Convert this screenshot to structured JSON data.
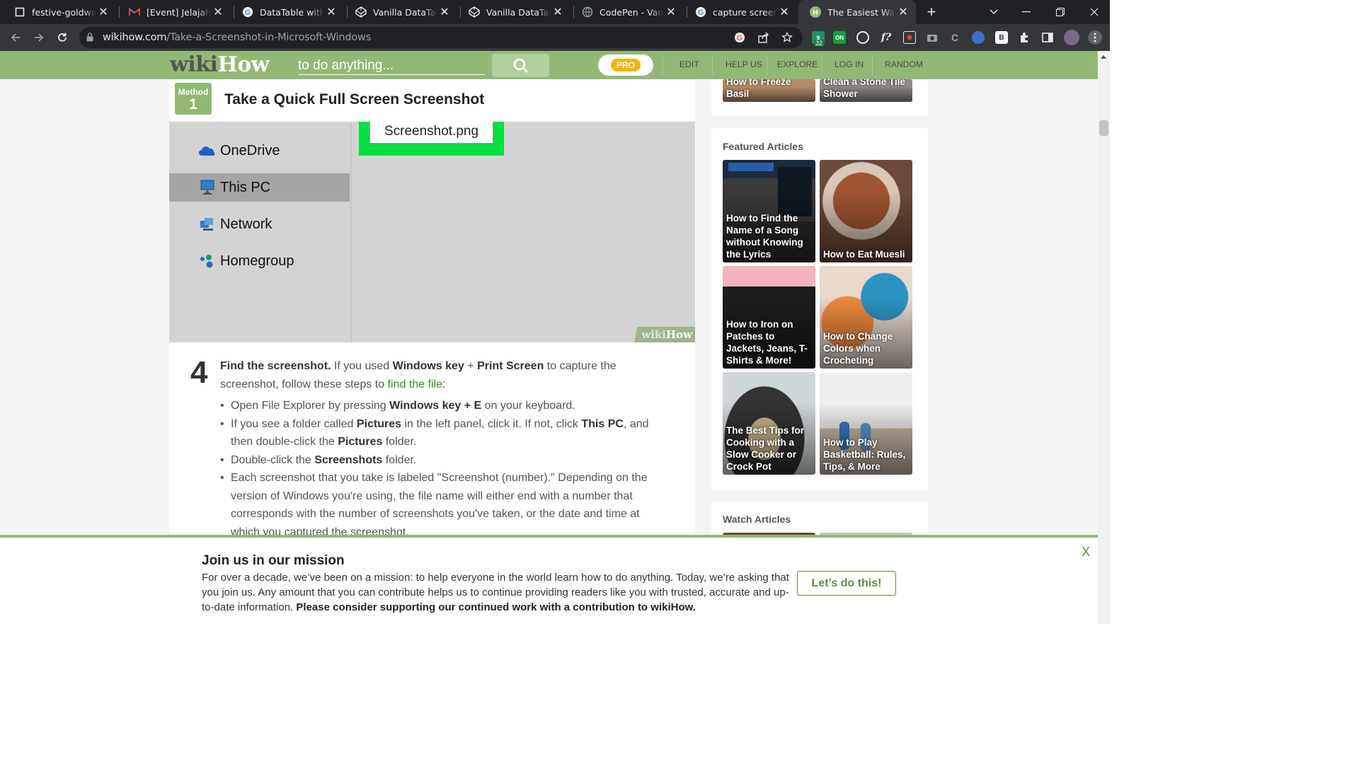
{
  "browser": {
    "tabs": [
      {
        "title": "festive-goldwasser",
        "icon": "codesandbox-icon"
      },
      {
        "title": "[Event] Jelajahi Du",
        "icon": "gmail-icon"
      },
      {
        "title": "DataTable without",
        "icon": "google-icon"
      },
      {
        "title": "Vanilla DataTables",
        "icon": "codepen-icon"
      },
      {
        "title": "Vanilla DataTables",
        "icon": "codepen-icon"
      },
      {
        "title": "CodePen - Vanilla",
        "icon": "globe-icon"
      },
      {
        "title": "capture screenshot",
        "icon": "google-icon"
      },
      {
        "title": "The Easiest Way to",
        "icon": "wikihow-icon",
        "active": true
      }
    ],
    "url_domain": "wikihow.com",
    "url_path": "/Take-a-Screenshot-in-Microsoft-Windows",
    "extension_badge": "32"
  },
  "header": {
    "logo_wiki": "wiki",
    "logo_how": "How",
    "search_placeholder": "to do anything...",
    "pro_label": "PRO",
    "nav": [
      "EDIT",
      "HELP US",
      "EXPLORE",
      "LOG IN",
      "RANDOM"
    ]
  },
  "article": {
    "method_label": "Method",
    "method_number": "1",
    "method_title": "Take a Quick Full Screen Screenshot",
    "image": {
      "file_name": "Screenshot.png",
      "nav_items": [
        "OneDrive",
        "This PC",
        "Network",
        "Homegroup"
      ],
      "selected_item": "This PC",
      "watermark_wiki": "wiki",
      "watermark_how": "How"
    },
    "step": {
      "number": "4",
      "lead": "Find the screenshot.",
      "t1": " If you used ",
      "k1": "Windows key",
      "t2": " + ",
      "k2": "Print Screen",
      "t3": " to capture the screenshot, follow these steps to ",
      "link": "find the file",
      "t4": ":",
      "bullets": [
        {
          "a": "Open File Explorer by pressing ",
          "b": "Windows key + E",
          "c": " on your keyboard."
        },
        {
          "a": "If you see a folder called ",
          "b": "Pictures",
          "c": " in the left panel, click it. If not, click ",
          "d": "This PC",
          "e": ", and then double-click the ",
          "f": "Pictures",
          "g": " folder."
        },
        {
          "a": "Double-click the ",
          "b": "Screenshots",
          "c": " folder."
        },
        {
          "a": "Each screenshot that you take is labeled \"Screenshot (number).\" Depending on the version of Windows you're using, the file name will either end with a number that corresponds with the number of screenshots you've taken, or the date and time at which you captured the screenshot."
        }
      ]
    }
  },
  "sidebar": {
    "related_top": [
      "How to Freeze Basil",
      "Clean a Stone Tile Shower"
    ],
    "featured_title": "Featured Articles",
    "featured": [
      {
        "title": "How to Find the Name of a Song without Knowing the Lyrics"
      },
      {
        "title": "How to Eat Muesli"
      },
      {
        "title": "How to Iron on Patches to Jackets, Jeans, T-Shirts & More!"
      },
      {
        "title": "How to Change Colors when Crocheting"
      },
      {
        "title": "The Best Tips for Cooking with a Slow Cooker or Crock Pot"
      },
      {
        "title": "How to Play Basketball: Rules, Tips, & More"
      }
    ],
    "watch_title": "Watch Articles"
  },
  "banner": {
    "title": "Join us in our mission",
    "body": "For over a decade, we’ve been on a mission: to help everyone in the world learn how to do anything. Today, we’re asking that you join us. Any amount that you can contribute helps us to continue providing readers like you with trusted, accurate and up-to-date information. ",
    "body_bold": "Please consider supporting our continued work with a contribution to wikiHow.",
    "cta": "Let’s do this!",
    "close": "X"
  },
  "colors": {
    "brand_green": "#93b874",
    "link_green": "#3a8a2a",
    "pro_yellow": "#f4b400"
  }
}
